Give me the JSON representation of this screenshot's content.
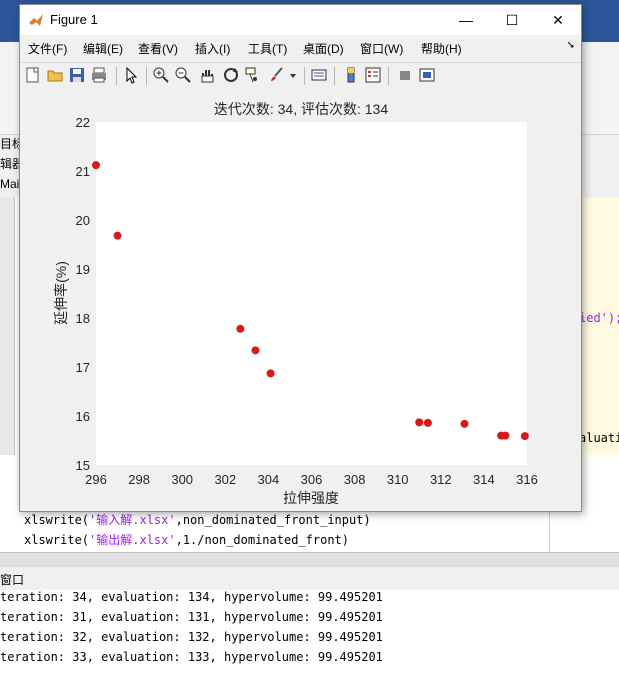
{
  "figure": {
    "window_title": "Figure 1",
    "minimize": "—",
    "maximize": "☐",
    "close": "✕",
    "menu": [
      "文件(F)",
      "编辑(E)",
      "查看(V)",
      "插入(I)",
      "工具(T)",
      "桌面(D)",
      "窗口(W)",
      "帮助(H)"
    ],
    "toolbar_icons": [
      "new-figure-icon",
      "open-file-icon",
      "save-icon",
      "print-icon",
      "pointer-icon",
      "zoom-in-icon",
      "zoom-out-icon",
      "pan-icon",
      "rotate-3d-icon",
      "data-cursor-icon",
      "brush-icon",
      "brush-dropdown-icon",
      "link-plot-icon",
      "insert-colorbar-icon",
      "insert-legend-icon",
      "hide-plot-tools-icon",
      "show-plot-tools-icon"
    ]
  },
  "background": {
    "left_tabs": [
      "目标",
      "辑器",
      "Main"
    ],
    "code_lines": [
      {
        "prefix": "xlswrite(",
        "str": "'输入解.xlsx'",
        "suffix": ",non_dominated_front_input)"
      },
      {
        "prefix": "xlswrite(",
        "str": "'输出解.xlsx'",
        "suffix": ",1./non_dominated_front)"
      }
    ],
    "right_fragment_1": "ied');",
    "right_fragment_2": "aluatio",
    "command_window_title": "窗口",
    "command_lines": [
      "teration: 31, evaluation: 131, hypervolume: 99.495201",
      "teration: 32, evaluation: 132, hypervolume: 99.495201",
      "teration: 33, evaluation: 133, hypervolume: 99.495201",
      "teration: 34, evaluation: 134, hypervolume: 99.495201"
    ]
  },
  "colors": {
    "marker": "#d41a1a",
    "axes_bg": "#ffffff",
    "figure_bg": "#f0f0f0",
    "string": "#a020f0"
  },
  "chart_data": {
    "type": "scatter",
    "title": "迭代次数: 34, 评估次数: 134",
    "xlabel": "拉伸强度",
    "ylabel": "延伸率(%)",
    "xlim": [
      296,
      316
    ],
    "ylim": [
      15,
      22
    ],
    "xticks": [
      296,
      298,
      300,
      302,
      304,
      306,
      308,
      310,
      312,
      314,
      316
    ],
    "yticks": [
      15,
      16,
      17,
      18,
      19,
      20,
      21,
      22
    ],
    "grid": false,
    "points": [
      {
        "x": 296.0,
        "y": 21.12
      },
      {
        "x": 297.0,
        "y": 19.68
      },
      {
        "x": 302.7,
        "y": 17.78
      },
      {
        "x": 303.4,
        "y": 17.34
      },
      {
        "x": 304.1,
        "y": 16.87
      },
      {
        "x": 311.0,
        "y": 15.87
      },
      {
        "x": 311.4,
        "y": 15.86
      },
      {
        "x": 313.1,
        "y": 15.84
      },
      {
        "x": 314.8,
        "y": 15.6
      },
      {
        "x": 315.0,
        "y": 15.6
      },
      {
        "x": 315.9,
        "y": 15.59
      }
    ]
  }
}
